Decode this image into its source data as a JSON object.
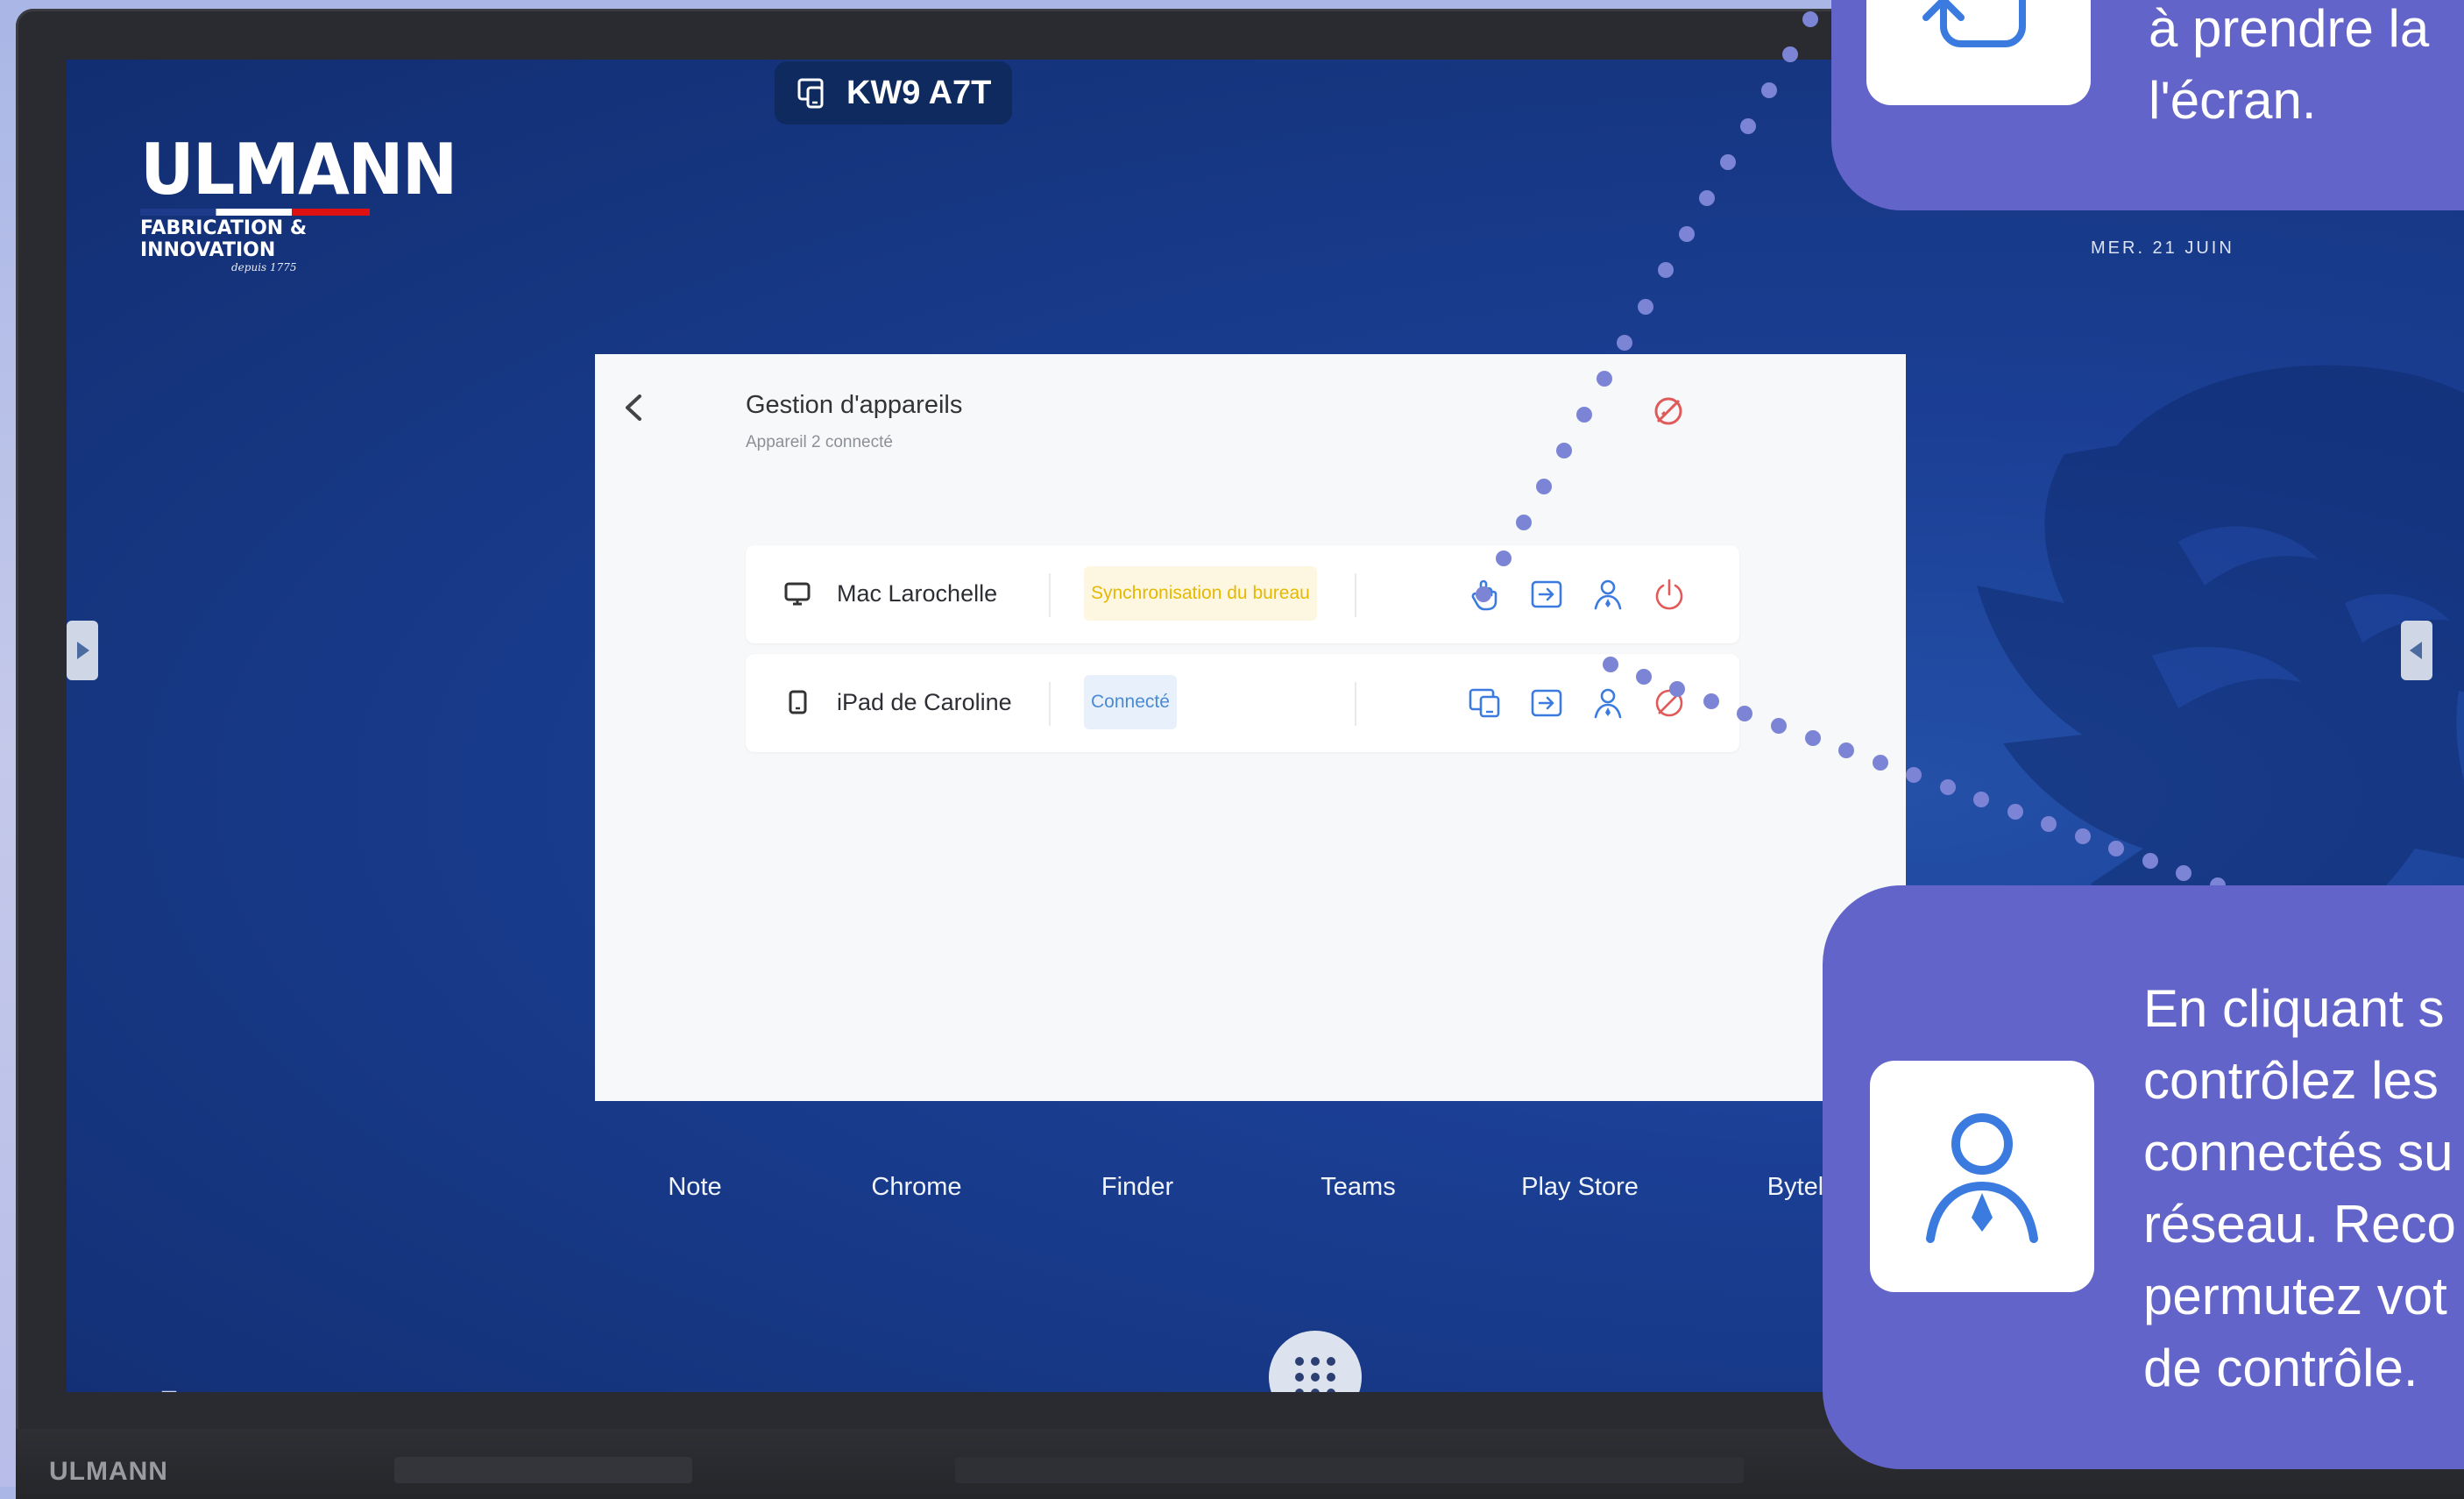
{
  "device_name": "KW9 A7T",
  "date": "MER. 21 JUIN",
  "logo": {
    "name": "ULMANN",
    "tagline": "FABRICATION & INNOVATION",
    "since": "depuis 1775"
  },
  "panel": {
    "title": "Gestion d'appareils",
    "subtitle": "Appareil 2 connecté",
    "devices": [
      {
        "name": "Mac Larochelle",
        "type": "desktop",
        "status": "Synchronisation du bureau",
        "status_kind": "sync",
        "actions": [
          "touch-control-icon",
          "share-screen-in-icon",
          "user-control-icon",
          "power-icon"
        ]
      },
      {
        "name": "iPad de Caroline",
        "type": "tablet",
        "status": "Connecté",
        "status_kind": "connected",
        "actions": [
          "mirror-screen-icon",
          "share-screen-in-icon",
          "user-control-icon",
          "disconnect-icon"
        ]
      }
    ]
  },
  "dock": {
    "apps": [
      "Note",
      "Chrome",
      "Finder",
      "Teams",
      "Play Store",
      "Bytello S"
    ]
  },
  "bezel_brand": "ULMANN",
  "callouts": {
    "top": {
      "lines": [
        "à prendre la",
        "l'écran."
      ]
    },
    "bottom": {
      "lines": [
        "En cliquant s",
        "contrôlez les",
        "connectés su",
        "réseau. Reco",
        "permutez vot",
        "de contrôle."
      ]
    }
  },
  "colors": {
    "screen_bg": "#1b3f95",
    "callout_bg": "#6364c9",
    "accent_blue": "#3b7be0",
    "status_sync": "#e6b800",
    "status_connected": "#4a8ad4",
    "danger": "#e05a5a"
  }
}
